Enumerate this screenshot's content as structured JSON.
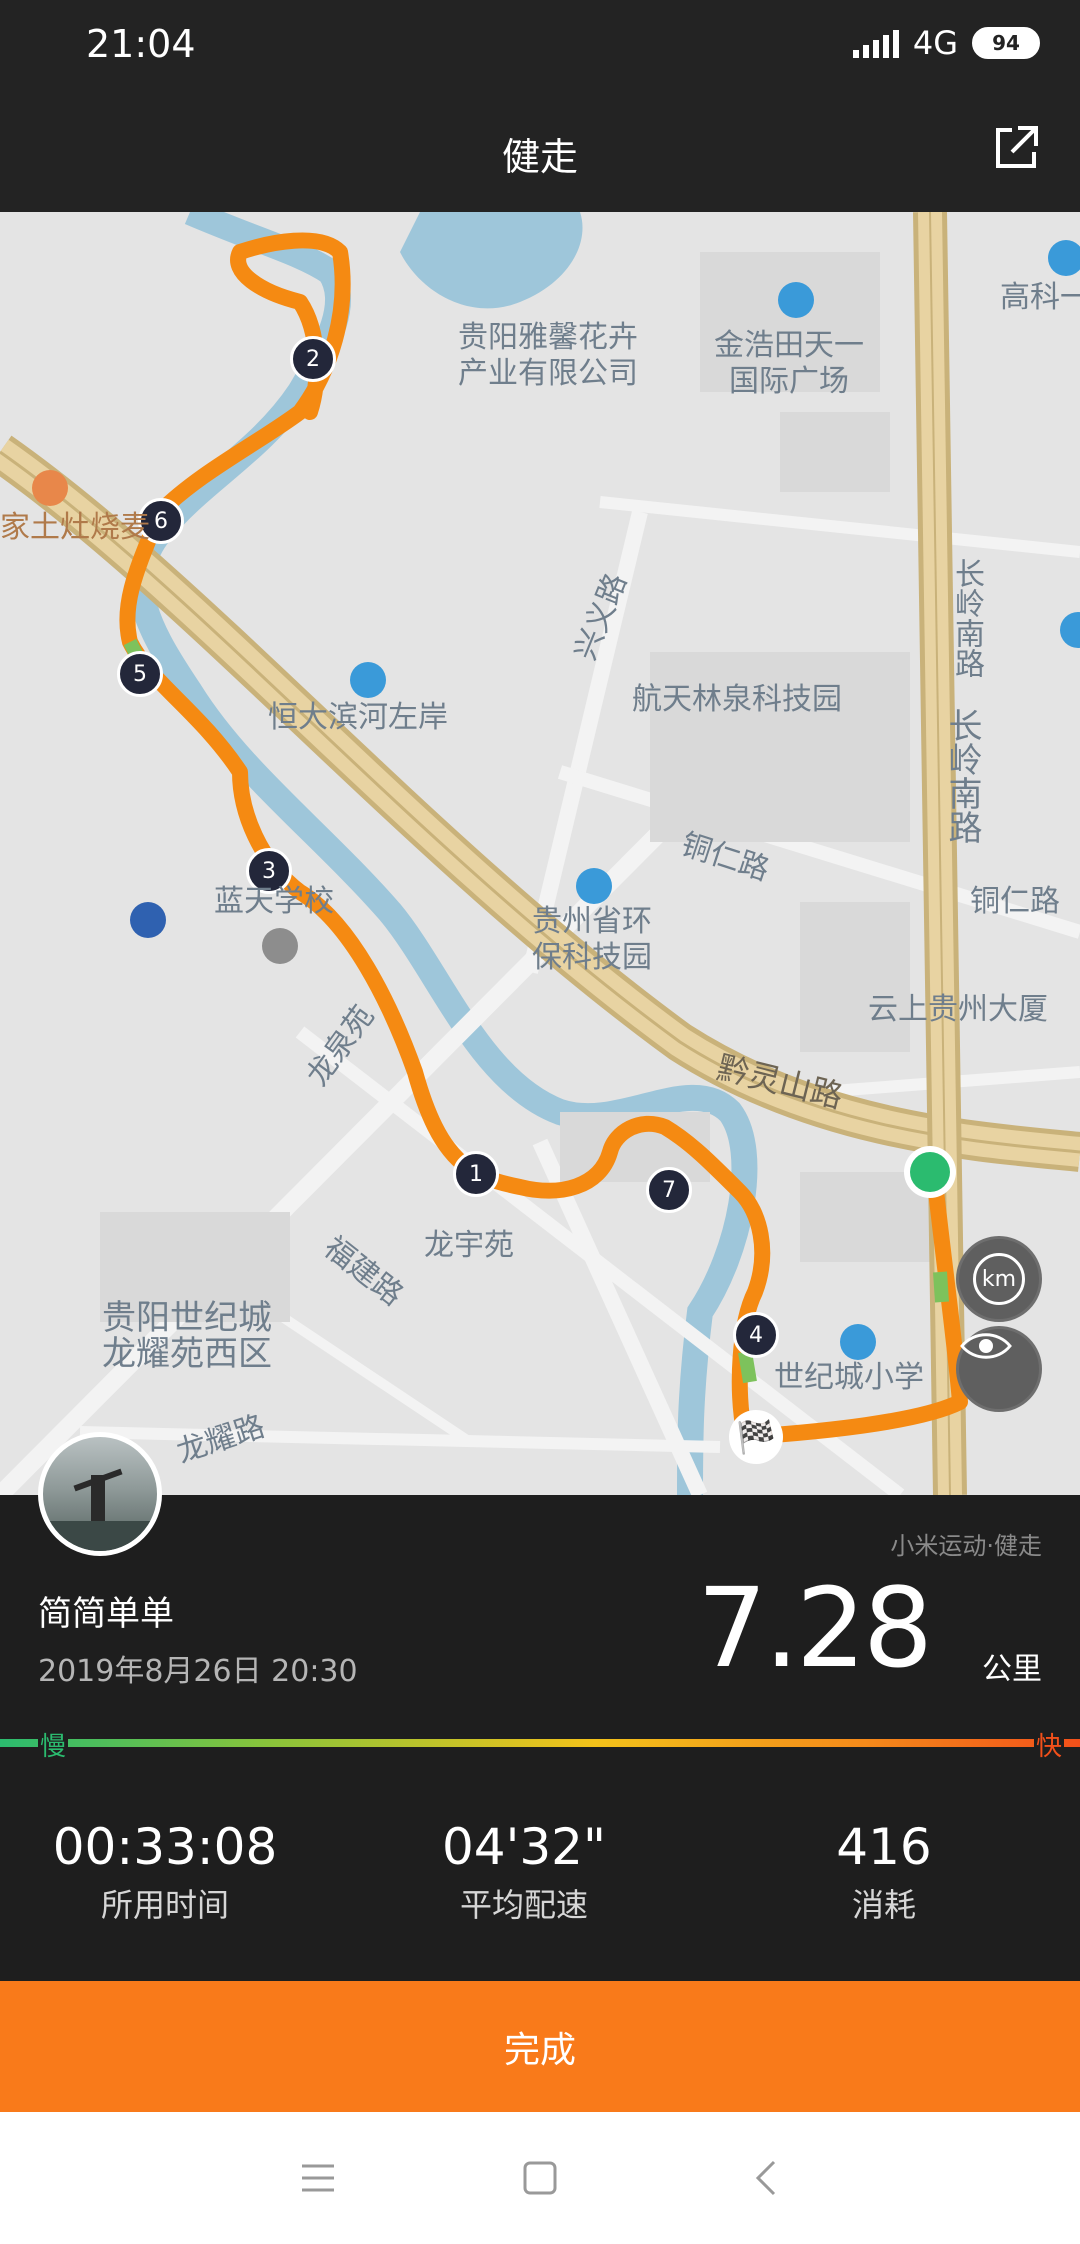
{
  "status_bar": {
    "time": "21:04",
    "network": "4G",
    "battery": "94"
  },
  "header": {
    "title": "健走"
  },
  "map": {
    "labels": {
      "company": "贵阳雅馨花卉\n产业有限公司",
      "jinhao": "金浩田天一\n国际广场",
      "gaoke": "高科一",
      "bbq": "家土灶烧麦",
      "hengda": "恒大滨河左岸",
      "xingyi": "兴义路",
      "hangtian": "航天林泉科技园",
      "changling1": "长岭南路",
      "changling2": "长岭南路",
      "tongren1": "铜仁路",
      "tongren2": "铜仁路",
      "lantian": "蓝天学校",
      "huanbao": "贵州省环\n保科技园",
      "yunshang": "云上贵州大厦",
      "qianling": "黔灵山路",
      "longquan": "龙泉苑",
      "longyu": "龙宇苑",
      "fujian": "福建路",
      "shijicheng": "贵阳世纪城\n龙耀苑西区",
      "school": "世纪城小学",
      "longyao": "龙耀路"
    },
    "markers": [
      "1",
      "2",
      "3",
      "4",
      "5",
      "6",
      "7"
    ],
    "km_label": "km"
  },
  "summary": {
    "user_name": "简简单单",
    "datetime": "2019年8月26日 20:30",
    "source": "小米运动·健走",
    "distance": "7.28",
    "distance_unit": "公里",
    "slow_label": "慢",
    "fast_label": "快"
  },
  "stats": [
    {
      "value": "00:33:08",
      "label": "所用时间"
    },
    {
      "value": "04'32\"",
      "label": "平均配速"
    },
    {
      "value": "416",
      "label": "消耗"
    }
  ],
  "finish_label": "完成"
}
